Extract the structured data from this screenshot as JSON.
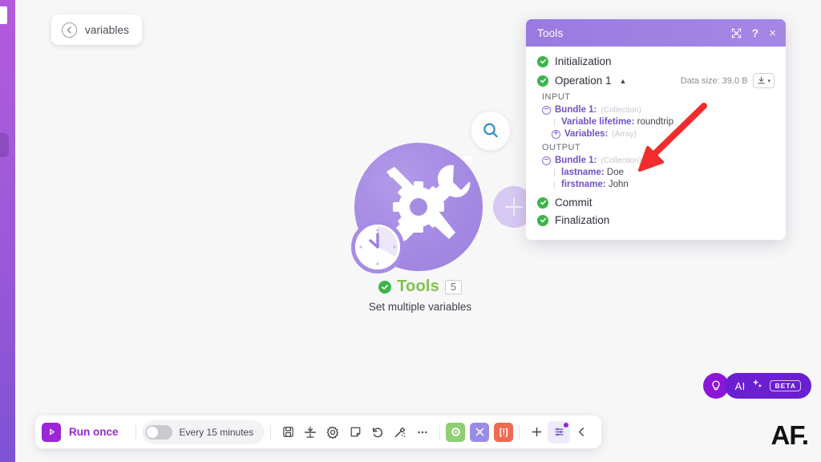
{
  "rail": {
    "name": "left-nav-rail"
  },
  "breadcrumb": {
    "back_icon": "arrow-left-circle-icon",
    "label": "variables"
  },
  "canvas": {
    "module": {
      "icon_name": "tools-module-icon",
      "thought_icon": "search-icon",
      "title": "Tools",
      "badge": "5",
      "subtitle": "Set multiple variables",
      "status_icon": "check-circle-icon"
    },
    "add_node": {
      "icon": "plus-icon",
      "label": "Add another module"
    }
  },
  "panel": {
    "title": "Tools",
    "header_icons": [
      {
        "name": "expand-icon",
        "glyph": "expand"
      },
      {
        "name": "help-icon",
        "glyph": "?"
      },
      {
        "name": "close-icon",
        "glyph": "×"
      }
    ],
    "steps": [
      {
        "label": "Initialization",
        "status": "ok"
      },
      {
        "label": "Operation 1",
        "status": "ok",
        "collapse_caret": "▲"
      }
    ],
    "data_size_label": "Data size: 39.0 B",
    "download_button": {
      "name": "download-button",
      "caret": "▾"
    },
    "input": {
      "section": "INPUT",
      "bundle": {
        "toggle": "−",
        "label": "Bundle 1:",
        "type": "(Collection)"
      },
      "fields": [
        {
          "key": "Variable lifetime:",
          "value": "roundtrip"
        }
      ],
      "nested": {
        "toggle": "+",
        "label": "Variables:",
        "type": "(Array)"
      }
    },
    "output": {
      "section": "OUTPUT",
      "bundle": {
        "toggle": "−",
        "label": "Bundle 1:",
        "type": "(Collection)"
      },
      "fields": [
        {
          "key": "lastname:",
          "value": "Doe"
        },
        {
          "key": "firstname:",
          "value": "John"
        }
      ]
    },
    "footer_steps": [
      {
        "label": "Commit",
        "status": "ok"
      },
      {
        "label": "Finalization",
        "status": "ok"
      }
    ]
  },
  "annotation": {
    "name": "red-arrow-annotation",
    "color": "#f22c2c"
  },
  "toolbar": {
    "run_label": "Run once",
    "run_icon": "play-icon",
    "schedule_label": "Every 15 minutes",
    "schedule_toggle_state": "off",
    "icons": [
      {
        "name": "save-icon"
      },
      {
        "name": "import-export-icon"
      },
      {
        "name": "settings-gear-icon"
      },
      {
        "name": "notes-icon"
      },
      {
        "name": "undo-icon"
      },
      {
        "name": "auto-align-icon"
      },
      {
        "name": "more-options-icon"
      }
    ],
    "color_buttons": [
      {
        "name": "run-module-button",
        "color": "#8fce72",
        "glyph": "●"
      },
      {
        "name": "unlink-button",
        "color": "#9a8ce6",
        "glyph": "✖"
      },
      {
        "name": "error-handler-button",
        "color": "#ef6a53",
        "glyph": "[!]"
      }
    ],
    "add_button": {
      "name": "add-module-button",
      "glyph": "+"
    },
    "filter_button": {
      "name": "filter-panel-button",
      "has_badge": true
    },
    "collapse_button": {
      "name": "collapse-toolbar-button",
      "glyph": "‹"
    }
  },
  "ai_widget": {
    "bulb": {
      "name": "ideas-lightbulb-button"
    },
    "label": "AI",
    "sparkle_icon": "sparkle-icon",
    "beta_label": "BETA"
  },
  "watermark": {
    "text": "AF."
  },
  "colors": {
    "accent_purple": "#9b27d6",
    "panel_header": "#9a7ae0",
    "status_green": "#3cb54a",
    "module_green": "#7fc24f",
    "annotation_red": "#f22c2c"
  }
}
